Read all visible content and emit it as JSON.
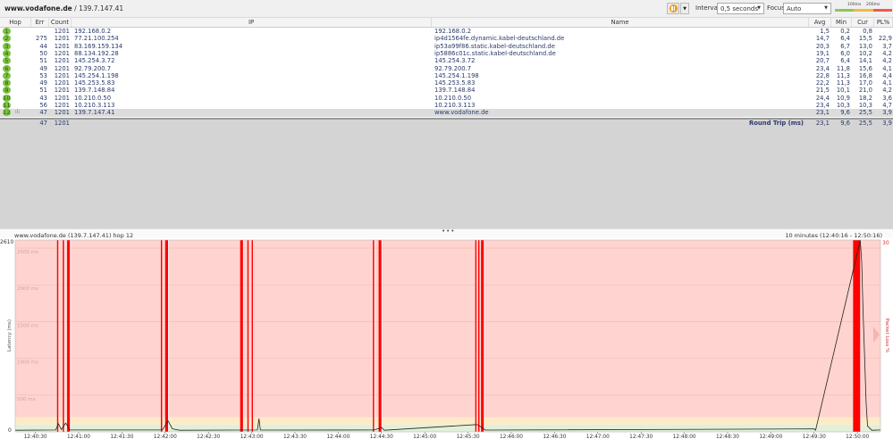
{
  "toolbar": {
    "target_host": "www.vodafone.de",
    "target_ip": "/ 139.7.147.41",
    "interval_label": "Interval",
    "interval_value": "0,5 seconds",
    "focus_label": "Focus",
    "focus_value": "Auto",
    "scale_labels": [
      "100ms",
      "200ms"
    ],
    "scale_colors": [
      "#8cc65a",
      "#f4b942",
      "#ef5a4c"
    ]
  },
  "table": {
    "columns": [
      "Hop",
      "Err",
      "Count",
      "IP",
      "Name",
      "Avg",
      "Min",
      "Cur",
      "PL%"
    ],
    "rows": [
      {
        "hop": "1",
        "err": "",
        "count": "1201",
        "ip": "192.168.0.2",
        "name": "192.168.0.2",
        "avg": "1,5",
        "min": "0,2",
        "cur": "0,8",
        "pl": ""
      },
      {
        "hop": "2",
        "err": "275",
        "count": "1201",
        "ip": "77.21.100.254",
        "name": "ip4d1564fe.dynamic.kabel-deutschland.de",
        "avg": "14,7",
        "min": "6,4",
        "cur": "15,5",
        "pl": "22,9"
      },
      {
        "hop": "3",
        "err": "44",
        "count": "1201",
        "ip": "83.169.159.134",
        "name": "ip53a99f86.static.kabel-deutschland.de",
        "avg": "20,3",
        "min": "6,7",
        "cur": "13,0",
        "pl": "3,7"
      },
      {
        "hop": "4",
        "err": "50",
        "count": "1201",
        "ip": "88.134.192.28",
        "name": "ip5886c01c.static.kabel-deutschland.de",
        "avg": "19,1",
        "min": "6,0",
        "cur": "10,2",
        "pl": "4,2"
      },
      {
        "hop": "5",
        "err": "51",
        "count": "1201",
        "ip": "145.254.3.72",
        "name": "145.254.3.72",
        "avg": "20,7",
        "min": "6,4",
        "cur": "14,1",
        "pl": "4,2"
      },
      {
        "hop": "6",
        "err": "49",
        "count": "1201",
        "ip": "92.79.200.7",
        "name": "92.79.200.7",
        "avg": "23,4",
        "min": "11,8",
        "cur": "15,6",
        "pl": "4,1"
      },
      {
        "hop": "7",
        "err": "53",
        "count": "1201",
        "ip": "145.254.1.198",
        "name": "145.254.1.198",
        "avg": "22,8",
        "min": "11,3",
        "cur": "16,8",
        "pl": "4,4"
      },
      {
        "hop": "8",
        "err": "49",
        "count": "1201",
        "ip": "145.253.5.83",
        "name": "145.253.5.83",
        "avg": "22,2",
        "min": "11,3",
        "cur": "17,0",
        "pl": "4,1"
      },
      {
        "hop": "9",
        "err": "51",
        "count": "1201",
        "ip": "139.7.148.84",
        "name": "139.7.148.84",
        "avg": "21,5",
        "min": "10,1",
        "cur": "21,0",
        "pl": "4,2"
      },
      {
        "hop": "10",
        "err": "43",
        "count": "1201",
        "ip": "10.210.0.50",
        "name": "10.210.0.50",
        "avg": "24,4",
        "min": "10,9",
        "cur": "18,2",
        "pl": "3,6"
      },
      {
        "hop": "11",
        "err": "56",
        "count": "1201",
        "ip": "10.210.3.113",
        "name": "10.210.3.113",
        "avg": "23,4",
        "min": "10,3",
        "cur": "10,3",
        "pl": "4,7"
      },
      {
        "hop": "12",
        "err": "47",
        "count": "1201",
        "ip": "139.7.147.41",
        "name": "www.vodafone.de",
        "avg": "23,1",
        "min": "9,6",
        "cur": "25,5",
        "pl": "3,9"
      }
    ],
    "summary": {
      "err": "47",
      "count": "1201",
      "label": "Round Trip (ms)",
      "avg": "23,1",
      "min": "9,6",
      "cur": "25,5",
      "pl": "3,9"
    }
  },
  "graph": {
    "title": "www.vodafone.de (139.7.147.41) hop 12",
    "range_label": "10 minutes (12:40:16 - 12:50:16)"
  },
  "chart_data": {
    "type": "line",
    "ylabel": "Latency (ms)",
    "y2label": "Packet Loss %",
    "ylim": [
      0,
      2610
    ],
    "y2lim": [
      0,
      30
    ],
    "y_max_label": "2610",
    "y_min_label": "0",
    "y2_max_label": "30",
    "y_ticks": [
      "500 ms",
      "1000 ms",
      "1500 ms",
      "2000 ms",
      "2500 ms"
    ],
    "y_tick_values": [
      500,
      1000,
      1500,
      2000,
      2500
    ],
    "xlim": [
      "12:40:16",
      "12:50:16"
    ],
    "x_ticks": [
      "12:40:30",
      "12:41:00",
      "12:41:30",
      "12:42:00",
      "12:42:30",
      "12:43:00",
      "12:43:30",
      "12:44:00",
      "12:44:30",
      "12:45:00",
      "12:45:30",
      "12:46:00",
      "12:46:30",
      "12:47:00",
      "12:47:30",
      "12:48:00",
      "12:48:30",
      "12:49:00",
      "12:49:30",
      "12:50:00"
    ],
    "zones": [
      {
        "from": 0,
        "to": 100,
        "color": "#e2f0d9"
      },
      {
        "from": 100,
        "to": 200,
        "color": "#fdebc8"
      },
      {
        "from": 200,
        "to": 2610,
        "color": "#ffd3cf"
      }
    ],
    "packet_loss_color": "#ff0000",
    "packet_loss_events": [
      {
        "time": "12:40:45",
        "seconds": 1
      },
      {
        "time": "12:40:49",
        "seconds": 1
      },
      {
        "time": "12:40:52",
        "seconds": 2
      },
      {
        "time": "12:41:57",
        "seconds": 1
      },
      {
        "time": "12:42:00",
        "seconds": 2
      },
      {
        "time": "12:42:52",
        "seconds": 2
      },
      {
        "time": "12:42:57",
        "seconds": 1
      },
      {
        "time": "12:43:00",
        "seconds": 1
      },
      {
        "time": "12:44:24",
        "seconds": 1
      },
      {
        "time": "12:44:28",
        "seconds": 2
      },
      {
        "time": "12:45:35",
        "seconds": 1
      },
      {
        "time": "12:45:37",
        "seconds": 1
      },
      {
        "time": "12:45:39",
        "seconds": 2
      },
      {
        "time": "12:49:57",
        "seconds": 5
      }
    ],
    "latency_points": [
      [
        "12:40:16",
        22
      ],
      [
        "12:40:44",
        25
      ],
      [
        "12:40:46",
        110
      ],
      [
        "12:40:48",
        30
      ],
      [
        "12:40:51",
        120
      ],
      [
        "12:40:54",
        25
      ],
      [
        "12:41:58",
        25
      ],
      [
        "12:42:02",
        150
      ],
      [
        "12:42:05",
        40
      ],
      [
        "12:42:10",
        22
      ],
      [
        "12:43:04",
        25
      ],
      [
        "12:43:05",
        180
      ],
      [
        "12:43:06",
        24
      ],
      [
        "12:44:25",
        25
      ],
      [
        "12:44:30",
        60
      ],
      [
        "12:44:32",
        22
      ],
      [
        "12:45:36",
        100
      ],
      [
        "12:45:38",
        80
      ],
      [
        "12:45:42",
        24
      ],
      [
        "12:49:30",
        40
      ],
      [
        "12:49:31",
        22
      ],
      [
        "12:50:02",
        2610
      ],
      [
        "12:50:03",
        2300
      ],
      [
        "12:50:04",
        1600
      ],
      [
        "12:50:05",
        1000
      ],
      [
        "12:50:06",
        400
      ],
      [
        "12:50:07",
        80
      ],
      [
        "12:50:10",
        22
      ],
      [
        "12:50:16",
        25
      ]
    ]
  }
}
